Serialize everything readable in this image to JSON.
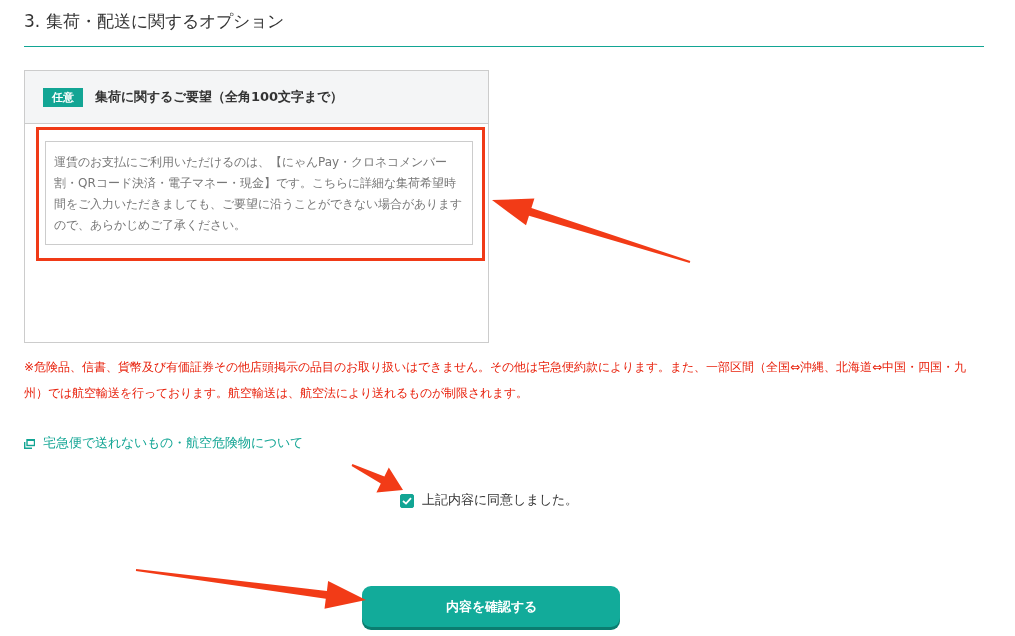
{
  "section_title": "3. 集荷・配送に関するオプション",
  "request_card": {
    "badge": "任意",
    "title": "集荷に関するご要望（全角100文字まで）",
    "placeholder": "運賃のお支払にご利用いただけるのは、【にゃんPay・クロネコメンバー割・QRコード決済・電子マネー・現金】です。こちらに詳細な集荷希望時間をご入力いただきましても、ご要望に沿うことができない場合がありますので、あらかじめご了承ください。",
    "highlighted": true
  },
  "notice": "※危険品、信書、貨幣及び有価証券その他店頭掲示の品目のお取り扱いはできません。その他は宅急便約款によります。また、一部区間（全国⇔沖縄、北海道⇔中国・四国・九州）では航空輸送を行っております。航空輸送は、航空法により送れるものが制限されます。",
  "link": "宅急便で送れないもの・航空危険物について",
  "agreement": {
    "label": "上記内容に同意しました。",
    "checked": true
  },
  "confirm_button": "内容を確認する",
  "annotation_arrows": [
    {
      "kind": "arrow"
    },
    {
      "kind": "arrow"
    },
    {
      "kind": "arrow"
    }
  ]
}
